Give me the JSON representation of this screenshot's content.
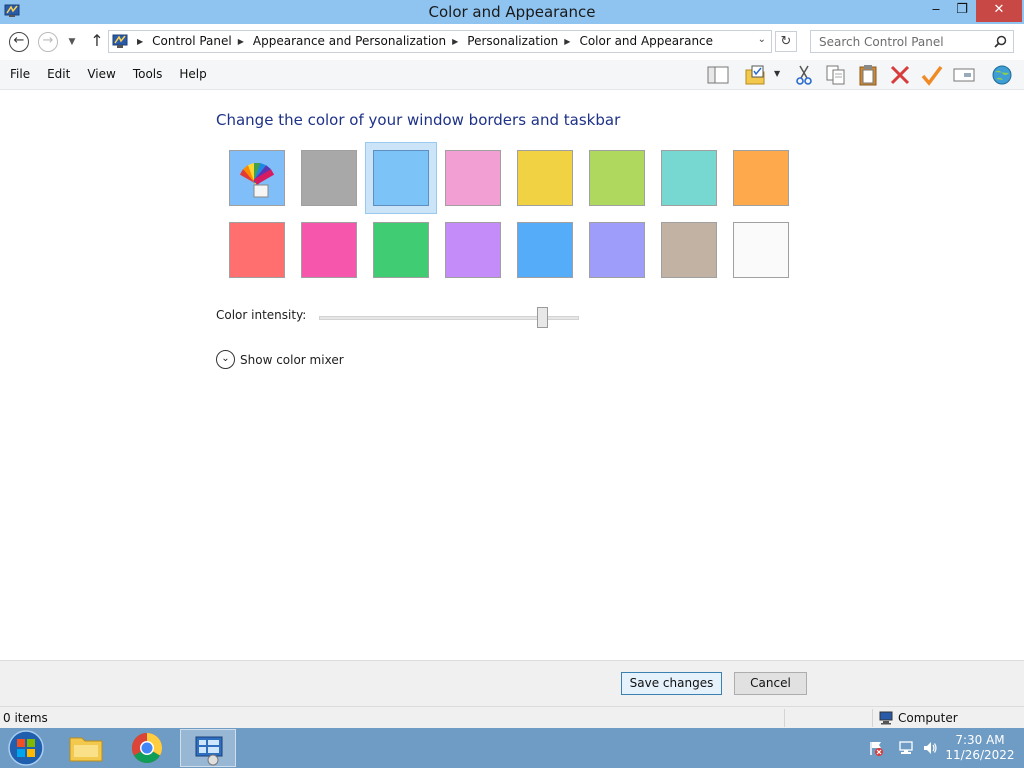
{
  "window": {
    "title": "Color and Appearance",
    "controls": {
      "minimize": "‒",
      "maximize": "❐",
      "close": "✕"
    }
  },
  "address": {
    "crumbs": [
      "Control Panel",
      "Appearance and Personalization",
      "Personalization",
      "Color and Appearance"
    ],
    "search_placeholder": "Search Control Panel"
  },
  "menu": [
    "File",
    "Edit",
    "View",
    "Tools",
    "Help"
  ],
  "toolbar_icons": [
    "layout-icon",
    "folder-options-icon",
    "cut-icon",
    "copy-icon",
    "paste-icon",
    "delete-icon",
    "checkmark-icon",
    "rename-icon",
    "globe-icon"
  ],
  "content": {
    "heading": "Change the color of your window borders and taskbar",
    "swatches": [
      {
        "name": "automatic",
        "color": "#7fbef8",
        "selected": false
      },
      {
        "name": "gray",
        "color": "#a8a8a8",
        "selected": false
      },
      {
        "name": "sky",
        "color": "#7cc4f8",
        "selected": true
      },
      {
        "name": "pink",
        "color": "#f29fd4",
        "selected": false
      },
      {
        "name": "yellow",
        "color": "#f0d242",
        "selected": false
      },
      {
        "name": "lime",
        "color": "#aed85e",
        "selected": false
      },
      {
        "name": "teal",
        "color": "#77d8d2",
        "selected": false
      },
      {
        "name": "orange",
        "color": "#ffa94d",
        "selected": false
      },
      {
        "name": "red",
        "color": "#ff6f6f",
        "selected": false
      },
      {
        "name": "magenta",
        "color": "#f656ab",
        "selected": false
      },
      {
        "name": "green",
        "color": "#40cc72",
        "selected": false
      },
      {
        "name": "violet",
        "color": "#c38cf8",
        "selected": false
      },
      {
        "name": "blue",
        "color": "#55acf9",
        "selected": false
      },
      {
        "name": "periwinkle",
        "color": "#9e9df9",
        "selected": false
      },
      {
        "name": "taupe",
        "color": "#c1b2a4",
        "selected": false
      },
      {
        "name": "white",
        "color": "#fafafa",
        "selected": false
      }
    ],
    "intensity_label": "Color intensity:",
    "intensity_value": 0.86,
    "mixer_label": "Show color mixer"
  },
  "footer": {
    "save_label": "Save changes",
    "cancel_label": "Cancel"
  },
  "status": {
    "items": "0 items",
    "location": "Computer"
  },
  "taskbar": {
    "time": "7:30 AM",
    "date": "11/26/2022"
  }
}
